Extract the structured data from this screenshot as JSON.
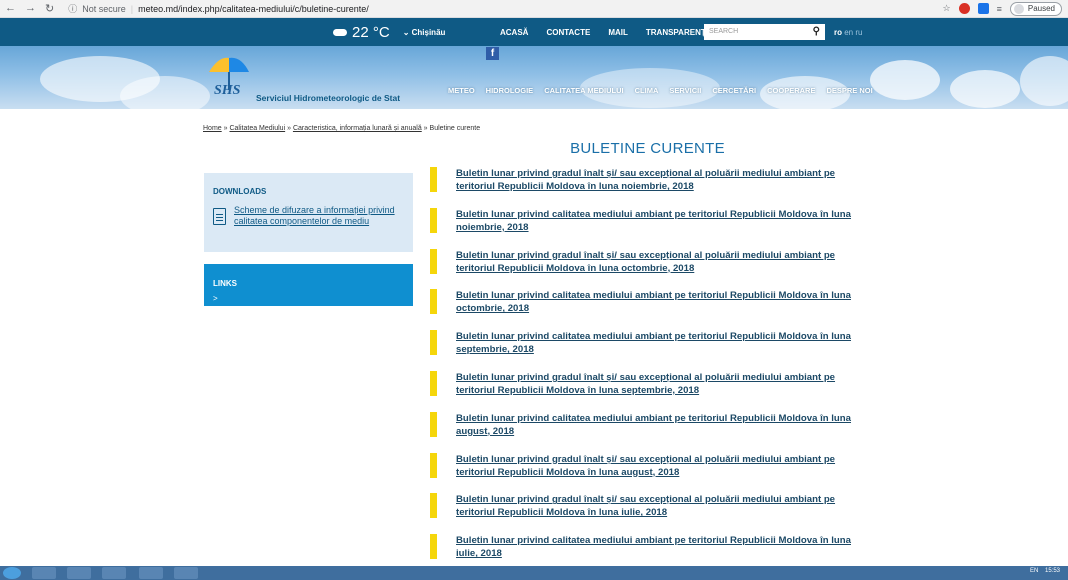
{
  "browser": {
    "security": "Not secure",
    "url": "meteo.md/index.php/calitatea-mediului/c/buletine-curente/",
    "paused_label": "Paused"
  },
  "topbar": {
    "temperature": "22 °C",
    "city": "Chișinău",
    "menu": [
      "ACASĂ",
      "CONTACTE",
      "MAIL",
      "TRANSPARENȚA"
    ],
    "search_placeholder": "SEARCH",
    "lang_active": "ro",
    "lang_other": "en ru"
  },
  "banner": {
    "org_name": "Serviciul Hidrometeorologic de Stat",
    "nav": [
      "METEO",
      "HIDROLOGIE",
      "CALITATEA MEDIULUI",
      "CLIMA",
      "SERVICII",
      "CERCETĂRI",
      "COOPERARE",
      "DESPRE NOI"
    ]
  },
  "breadcrumb": {
    "home": "Home",
    "sep": " » ",
    "level1": "Calitatea Mediului",
    "level2": "Caracteristica, informația lunară și anuală",
    "current": "Buletine curente"
  },
  "page_title": "BULETINE CURENTE",
  "sidebar": {
    "downloads_heading": "DOWNLOADS",
    "downloads_link": "Scheme de difuzare a informației privind calitatea componentelor de mediu",
    "links_heading": "LINKS",
    "links_more": ">"
  },
  "bulletins": [
    " Buletin lunar privind gradul înalt și/ sau excepțional al poluării mediului ambiant pe teritoriul Republicii Moldova în luna noiembrie, 2018 ",
    " Buletin lunar privind calitatea mediului ambiant pe teritoriul Republicii Moldova în luna noiembrie, 2018",
    "Buletin lunar privind gradul înalt și/ sau excepțional al poluării mediului ambiant pe teritoriul Republicii Moldova în luna octombrie, 2018 ",
    " Buletin lunar privind calitatea mediului ambiant pe teritoriul Republicii Moldova în luna octombrie, 2018",
    "Buletin lunar privind calitatea mediului ambiant pe teritoriul Republicii Moldova în luna septembrie, 2018 ",
    "Buletin lunar privind gradul înalt și/ sau excepțional al poluării mediului ambiant pe teritoriul Republicii Moldova în luna septembrie, 2018 ",
    " Buletin lunar privind calitatea mediului ambiant pe teritoriul Republicii Moldova în luna august, 2018",
    " Buletin lunar privind  gradul înalt și/ sau excepțional al poluării mediului ambiant pe teritoriul Republicii Moldova în luna august, 2018",
    "Buletin lunar privind  gradul înalt și/ sau excepțional al poluării mediului ambiant pe teritoriul Republicii Moldova în luna iulie, 2018",
    " Buletin lunar privind calitatea mediului ambiant pe teritoriul Republicii Moldova în luna iulie, 2018"
  ],
  "taskbar": {
    "lang": "EN",
    "time": "15:53"
  },
  "colors": {
    "topbar": "#0f5a85",
    "accent_yellow": "#f5d60b",
    "links_box": "#0f8fd0",
    "title_blue": "#1a6fa8"
  }
}
